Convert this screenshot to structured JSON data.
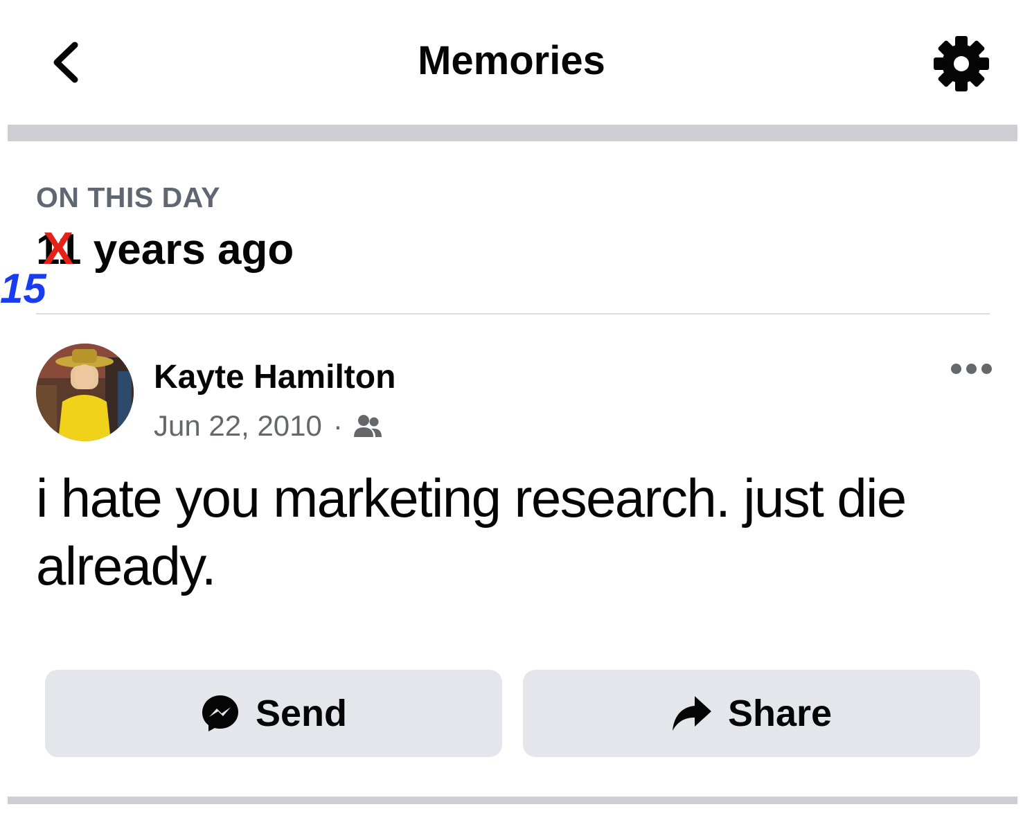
{
  "header": {
    "title": "Memories",
    "back_icon": "chevron-left-icon",
    "settings_icon": "gear-icon"
  },
  "memory": {
    "kicker": "ON THIS DAY",
    "years_original_prefix": "11",
    "years_suffix": " years ago",
    "strike_mark": "X",
    "corrected_years": "15"
  },
  "post": {
    "author": "Kayte Hamilton",
    "date": "Jun 22, 2010",
    "separator": "·",
    "audience_icon": "friends-icon",
    "more_icon": "more-horizontal-icon",
    "text": "i hate you marketing research. just die already."
  },
  "actions": {
    "send_label": "Send",
    "send_icon": "messenger-icon",
    "share_label": "Share",
    "share_icon": "share-arrow-icon"
  },
  "colors": {
    "strike": "#e62117",
    "correction": "#1a3cf0",
    "button_bg": "#e4e6eb",
    "divider": "#cfced5"
  }
}
